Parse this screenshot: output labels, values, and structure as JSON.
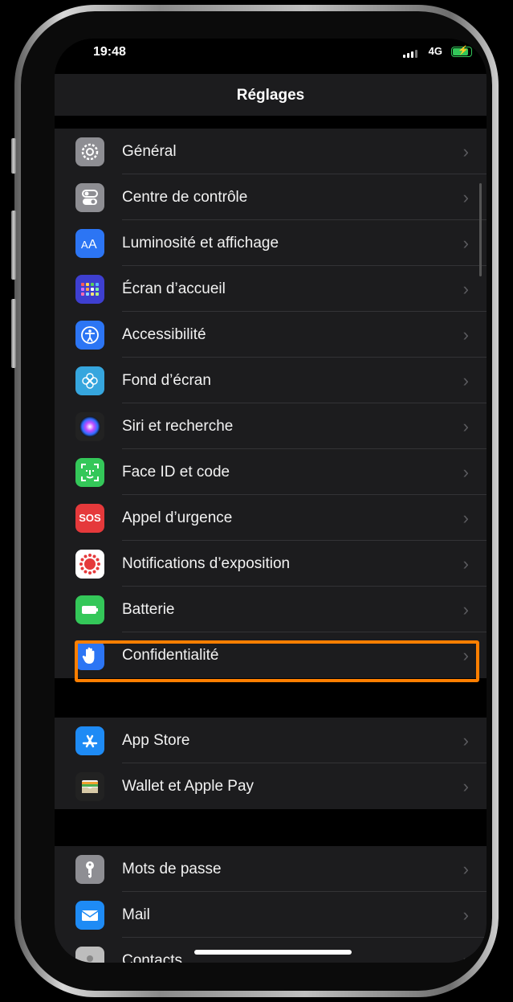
{
  "status_bar": {
    "time": "19:48",
    "network": "4G"
  },
  "nav": {
    "title": "Réglages"
  },
  "group1": [
    {
      "label": "Général",
      "icon": "gear-icon",
      "bg": "#8e8e93"
    },
    {
      "label": "Centre de contrôle",
      "icon": "toggles-icon",
      "bg": "#8e8e93"
    },
    {
      "label": "Luminosité et affichage",
      "icon": "text-size-icon",
      "bg": "#2c75f4"
    },
    {
      "label": "Écran d’accueil",
      "icon": "app-grid-icon",
      "bg": "#3e3fd0"
    },
    {
      "label": "Accessibilité",
      "icon": "accessibility-icon",
      "bg": "#2c75f4"
    },
    {
      "label": "Fond d’écran",
      "icon": "flower-icon",
      "bg": "#36a6de"
    },
    {
      "label": "Siri et recherche",
      "icon": "siri-icon",
      "bg": "#222"
    },
    {
      "label": "Face ID et code",
      "icon": "face-id-icon",
      "bg": "#34c759"
    },
    {
      "label": "Appel d’urgence",
      "icon": "sos-icon",
      "bg": "#e5393b",
      "icon_text": "SOS"
    },
    {
      "label": "Notifications d’exposition",
      "icon": "exposure-icon",
      "bg": "#ffffff"
    },
    {
      "label": "Batterie",
      "icon": "battery-icon",
      "bg": "#34c759"
    },
    {
      "label": "Confidentialité",
      "icon": "hand-icon",
      "bg": "#2c75f4"
    }
  ],
  "group2": [
    {
      "label": "App Store",
      "icon": "app-store-icon",
      "bg": "#1e8bf5"
    },
    {
      "label": "Wallet et Apple Pay",
      "icon": "wallet-icon",
      "bg": "#222"
    }
  ],
  "group3": [
    {
      "label": "Mots de passe",
      "icon": "key-icon",
      "bg": "#8e8e93"
    },
    {
      "label": "Mail",
      "icon": "mail-icon",
      "bg": "#1e8bf5"
    },
    {
      "label": "Contacts",
      "icon": "contacts-icon",
      "bg": "#bdbdbd"
    }
  ],
  "highlight_color": "#ff7f00"
}
